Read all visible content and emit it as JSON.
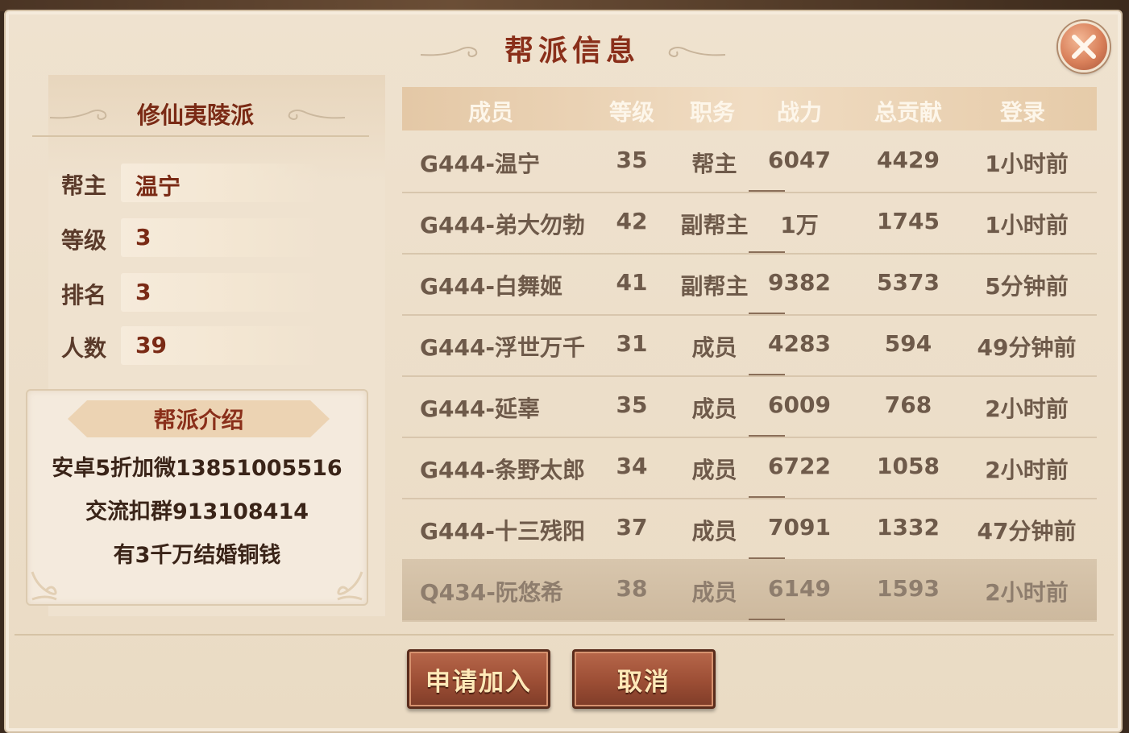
{
  "dialog": {
    "title": "帮派信息"
  },
  "guild": {
    "name": "修仙夷陵派",
    "fields": [
      {
        "label": "帮主",
        "value": "温宁"
      },
      {
        "label": "等级",
        "value": "3"
      },
      {
        "label": "排名",
        "value": "3"
      },
      {
        "label": "人数",
        "value": "39"
      }
    ],
    "intro_title": "帮派介绍",
    "intro_lines": [
      "安卓5折加微13851005516",
      "交流扣群913108414",
      "有3千万结婚铜钱"
    ]
  },
  "table": {
    "headers": [
      "成员",
      "等级",
      "职务",
      "战力",
      "总贡献",
      "登录"
    ],
    "rows": [
      [
        "G444-温宁",
        "35",
        "帮主",
        "6047",
        "4429",
        "1小时前"
      ],
      [
        "G444-弟大勿勃",
        "42",
        "副帮主",
        "1万",
        "1745",
        "1小时前"
      ],
      [
        "G444-白舞姬",
        "41",
        "副帮主",
        "9382",
        "5373",
        "5分钟前"
      ],
      [
        "G444-浮世万千",
        "31",
        "成员",
        "4283",
        "594",
        "49分钟前"
      ],
      [
        "G444-延辜",
        "35",
        "成员",
        "6009",
        "768",
        "2小时前"
      ],
      [
        "G444-条野太郎",
        "34",
        "成员",
        "6722",
        "1058",
        "2小时前"
      ],
      [
        "G444-十三残阳",
        "37",
        "成员",
        "7091",
        "1332",
        "47分钟前"
      ],
      [
        "Q434-阮悠希",
        "38",
        "成员",
        "6149",
        "1593",
        "2小时前"
      ]
    ]
  },
  "buttons": {
    "apply": "申请加入",
    "cancel": "取消"
  },
  "icons": {
    "close": "close-x-icon",
    "swirl": "cloud-swirl-icon"
  },
  "colors": {
    "title": "#8a2f1a",
    "button": "#9c4e35",
    "button_text": "#ffe9b8",
    "panel_bg": "#efe2cf"
  }
}
